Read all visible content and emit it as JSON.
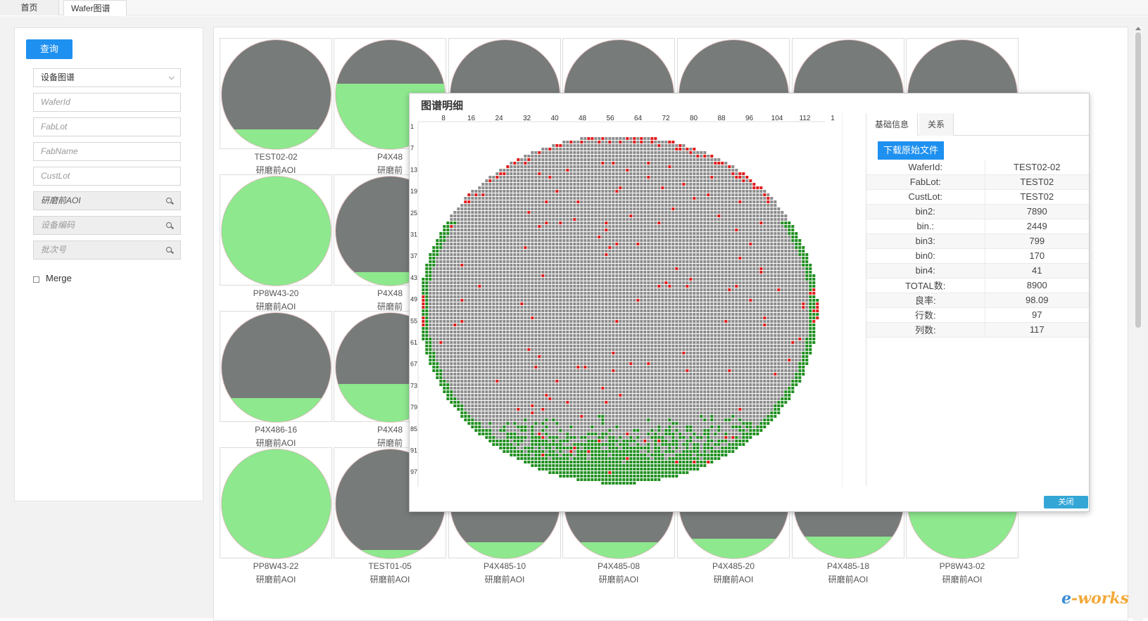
{
  "tabs": {
    "home": "首页",
    "wafer": "Wafer图谱",
    "close_icon": "close-icon"
  },
  "filter": {
    "query_button": "查询",
    "map_type": "设备图谱",
    "wafer_id_placeholder": "WaferId",
    "fablot_placeholder": "FabLot",
    "fabname_placeholder": "FabName",
    "custlot_placeholder": "CustLot",
    "process_value": "研磨前AOI",
    "device_code_placeholder": "设备编码",
    "batch_placeholder": "批次号",
    "merge_label": "Merge"
  },
  "gallery": {
    "cards": [
      {
        "name": "TEST02-02",
        "process": "研磨前AOI",
        "green": 0.18
      },
      {
        "name": "P4X48",
        "process": "研磨前",
        "green": 0.6
      },
      {
        "name": "",
        "process": "",
        "green": 0.1
      },
      {
        "name": "",
        "process": "",
        "green": 0.1
      },
      {
        "name": "",
        "process": "",
        "green": 0.1
      },
      {
        "name": "",
        "process": "",
        "green": 0.1
      },
      {
        "name": "",
        "process": "",
        "green": 0.1
      },
      {
        "name": "PP8W43-20",
        "process": "研磨前AOI",
        "green": 1.0
      },
      {
        "name": "P4X48",
        "process": "研磨前",
        "green": 0.12
      },
      {
        "name": "P4X486-16",
        "process": "研磨前AOI",
        "green": 0.22
      },
      {
        "name": "P4X48",
        "process": "研磨前",
        "green": 0.35
      },
      {
        "name": "PP8W43-22",
        "process": "研磨前AOI",
        "green": 1.0
      },
      {
        "name": "TEST01-05",
        "process": "研磨前AOI",
        "green": 0.08
      },
      {
        "name": "P4X485-10",
        "process": "研磨前AOI",
        "green": 0.15
      },
      {
        "name": "P4X485-08",
        "process": "研磨前AOI",
        "green": 0.15
      },
      {
        "name": "P4X485-20",
        "process": "研磨前AOI",
        "green": 0.18
      },
      {
        "name": "P4X485-18",
        "process": "研磨前AOI",
        "green": 0.2
      },
      {
        "name": "PP8W43-02",
        "process": "研磨前AOI",
        "green": 0.5
      }
    ]
  },
  "modal": {
    "title": "图谱明细",
    "tab_basic": "基础信息",
    "tab_relation": "关系",
    "download_button": "下载原始文件",
    "close_button": "关闭",
    "col_ticks": [
      "8",
      "16",
      "24",
      "32",
      "40",
      "48",
      "56",
      "64",
      "72",
      "80",
      "88",
      "96",
      "104",
      "112",
      "1"
    ],
    "row_ticks": [
      "1",
      "7",
      "13",
      "19",
      "25",
      "31",
      "37",
      "43",
      "49",
      "55",
      "61",
      "67",
      "73",
      "79",
      "85",
      "91",
      "97"
    ],
    "info": [
      {
        "k": "WaferId:",
        "v": "TEST02-02"
      },
      {
        "k": "FabLot:",
        "v": "TEST02"
      },
      {
        "k": "CustLot:",
        "v": "TEST02"
      },
      {
        "k": "bin2:",
        "v": "7890"
      },
      {
        "k": "bin.:",
        "v": "2449"
      },
      {
        "k": "bin3:",
        "v": "799"
      },
      {
        "k": "bin0:",
        "v": "170"
      },
      {
        "k": "bin4:",
        "v": "41"
      },
      {
        "k": "TOTAL数:",
        "v": "8900"
      },
      {
        "k": "良率:",
        "v": "98.09"
      },
      {
        "k": "行数:",
        "v": "97"
      },
      {
        "k": "列数:",
        "v": "117"
      }
    ],
    "colors": {
      "pass": "#8c8c8c",
      "edge": "#1f8f1f",
      "fail": "#e01b1b"
    }
  },
  "watermark": {
    "prefix": "e",
    "text": "-works"
  }
}
